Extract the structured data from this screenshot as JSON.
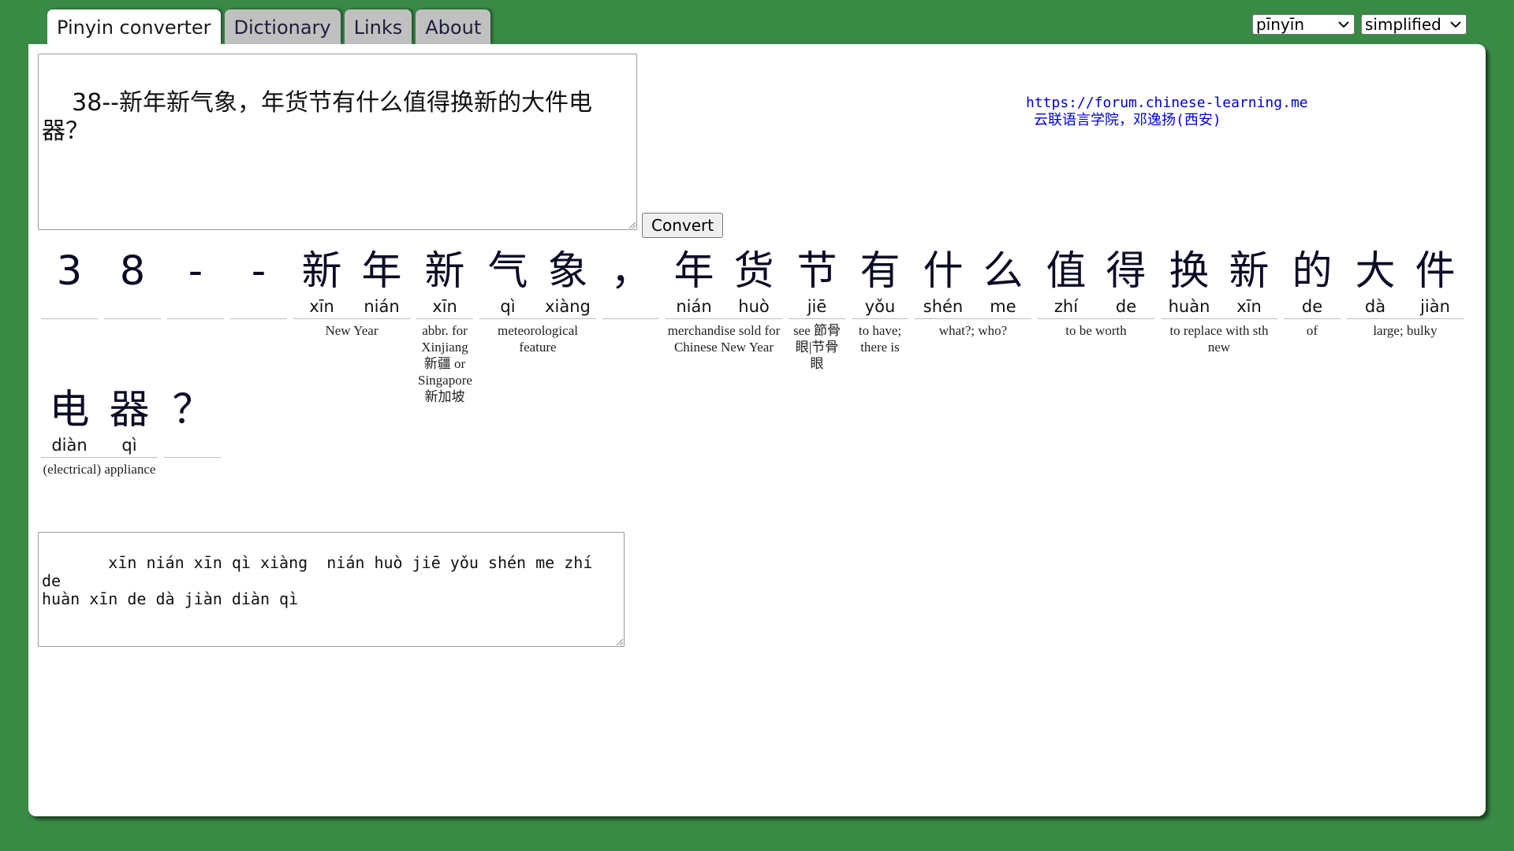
{
  "tabs": [
    {
      "label": "Pinyin converter",
      "active": true
    },
    {
      "label": "Dictionary",
      "active": false
    },
    {
      "label": "Links",
      "active": false
    },
    {
      "label": "About",
      "active": false
    }
  ],
  "selects": {
    "romanization": "pīnyīn",
    "script": "simplified"
  },
  "input": {
    "value": "38--新年新气象，年货节有什么值得换新的大件电器？"
  },
  "convert_label": "Convert",
  "credit": {
    "url": "https://forum.chinese-learning.me",
    "cn": "云联语言学院，邓逸扬(西安)"
  },
  "words": [
    {
      "chars": [
        {
          "hz": "3",
          "py": ""
        }
      ],
      "gloss": ""
    },
    {
      "chars": [
        {
          "hz": "8",
          "py": ""
        }
      ],
      "gloss": ""
    },
    {
      "chars": [
        {
          "hz": "-",
          "py": ""
        }
      ],
      "gloss": ""
    },
    {
      "chars": [
        {
          "hz": "-",
          "py": ""
        }
      ],
      "gloss": ""
    },
    {
      "chars": [
        {
          "hz": "新",
          "py": "xīn"
        },
        {
          "hz": "年",
          "py": "nián"
        }
      ],
      "gloss": "New Year"
    },
    {
      "chars": [
        {
          "hz": "新",
          "py": "xīn"
        }
      ],
      "gloss": "abbr. for Xinjiang 新疆 or Singapore 新加坡"
    },
    {
      "chars": [
        {
          "hz": "气",
          "py": "qì"
        },
        {
          "hz": "象",
          "py": "xiàng"
        }
      ],
      "gloss": "meteorological feature"
    },
    {
      "chars": [
        {
          "hz": "，",
          "py": ""
        }
      ],
      "gloss": ""
    },
    {
      "chars": [
        {
          "hz": "年",
          "py": "nián"
        },
        {
          "hz": "货",
          "py": "huò"
        }
      ],
      "gloss": "merchandise sold for Chinese New Year"
    },
    {
      "chars": [
        {
          "hz": "节",
          "py": "jiē"
        }
      ],
      "gloss": "see 節骨眼|节骨眼"
    },
    {
      "chars": [
        {
          "hz": "有",
          "py": "yǒu"
        }
      ],
      "gloss": "to have; there is"
    },
    {
      "chars": [
        {
          "hz": "什",
          "py": "shén"
        },
        {
          "hz": "么",
          "py": "me"
        }
      ],
      "gloss": "what?; who?"
    },
    {
      "chars": [
        {
          "hz": "值",
          "py": "zhí"
        },
        {
          "hz": "得",
          "py": "de"
        }
      ],
      "gloss": "to be worth"
    },
    {
      "chars": [
        {
          "hz": "换",
          "py": "huàn"
        },
        {
          "hz": "新",
          "py": "xīn"
        }
      ],
      "gloss": "to replace with sth new"
    },
    {
      "chars": [
        {
          "hz": "的",
          "py": "de"
        }
      ],
      "gloss": "of"
    },
    {
      "chars": [
        {
          "hz": "大",
          "py": "dà"
        },
        {
          "hz": "件",
          "py": "jiàn"
        }
      ],
      "gloss": "large; bulky"
    },
    {
      "chars": [
        {
          "hz": "电",
          "py": "diàn"
        },
        {
          "hz": "器",
          "py": "qì"
        }
      ],
      "gloss": "(electrical) appliance"
    },
    {
      "chars": [
        {
          "hz": "？",
          "py": ""
        }
      ],
      "gloss": ""
    }
  ],
  "output": {
    "value": "   xīn nián xīn qì xiàng  nián huò jiē yǒu shén me zhí de\nhuàn xīn de dà jiàn diàn qì"
  }
}
